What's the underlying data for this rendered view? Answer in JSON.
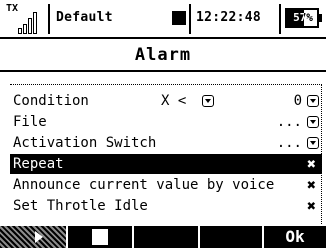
{
  "status": {
    "tx_label": "TX",
    "signal_level": 4,
    "model_name": "Default",
    "clock": "12:22:48",
    "battery_percent": "57%",
    "battery_level": 0.57
  },
  "page": {
    "title": "Alarm"
  },
  "rows": [
    {
      "label": "Condition",
      "middle": "X <",
      "right": "0"
    },
    {
      "label": "File",
      "right": "..."
    },
    {
      "label": "Activation Switch",
      "right": "..."
    },
    {
      "label": "Repeat",
      "selected": true
    },
    {
      "label": "Announce current value by voice"
    },
    {
      "label": "Set Throtle Idle"
    }
  ],
  "softkeys": {
    "f5": "Ok"
  },
  "icons": {
    "dropdown": "dropdown-arrow-icon",
    "disabled": "x-icon",
    "next": "arrow-right-icon",
    "stop": "stop-square-icon"
  }
}
